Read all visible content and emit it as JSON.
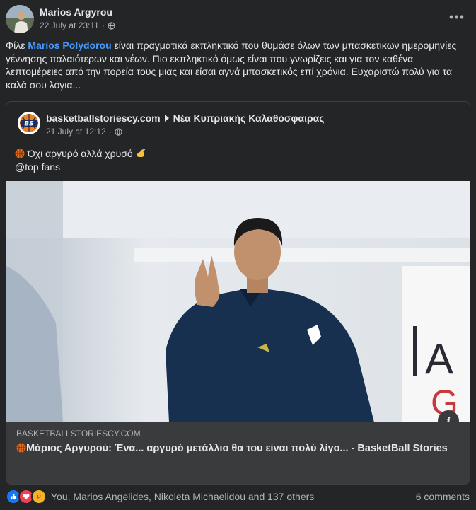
{
  "post": {
    "author": "Marios Argyrou",
    "timestamp": "22 July at 23:11",
    "audience_icon": "globe-icon",
    "more_icon": "more-dots-icon",
    "more_label": "•••",
    "text_before": "Φίλε ",
    "mention": "Marios Polydorou",
    "text_after": " είναι πραγματικά εκπληκτικό που θυμάσε όλων των μπασκετικων ημερομηνίες γέννησης παλαιότερων και νέων. Πιο εκπληκτικό όμως είναι που γνωρίζεις και για τον καθένα λεπτομέρειες από την πορεία τους μιας και είσαι αγνά μπασκετικός επί χρόνια. Ευχαριστώ πολύ για τα καλά σου λόγια..."
  },
  "shared": {
    "logo_text": "BS",
    "source": "basketballstoriescy.com",
    "group": "Νέα Κυπριακής Καλαθόσφαιρας",
    "timestamp": "21 July at 12:12",
    "line1": "Όχι αργυρό αλλά χρυσό",
    "line2": "@top fans",
    "info_label": "i",
    "link_domain": "BASKETBALLSTORIESCY.COM",
    "link_title": "Μάριος Αργυρού: Ένα... αργυρό μετάλλιο θα του είναι πολύ λίγο... - BasketBall Stories"
  },
  "footer": {
    "reactions": [
      "like-reaction-icon",
      "love-reaction-icon",
      "care-reaction-icon"
    ],
    "reaction_summary": "You, Marios Angelides, Nikoleta Michaelidou and 137 others",
    "comments": "6 comments"
  },
  "colors": {
    "background": "#242526",
    "link_area": "#3a3b3c",
    "mention": "#4599ff",
    "text": "#e4e6eb",
    "secondary_text": "#b0b3b8"
  }
}
